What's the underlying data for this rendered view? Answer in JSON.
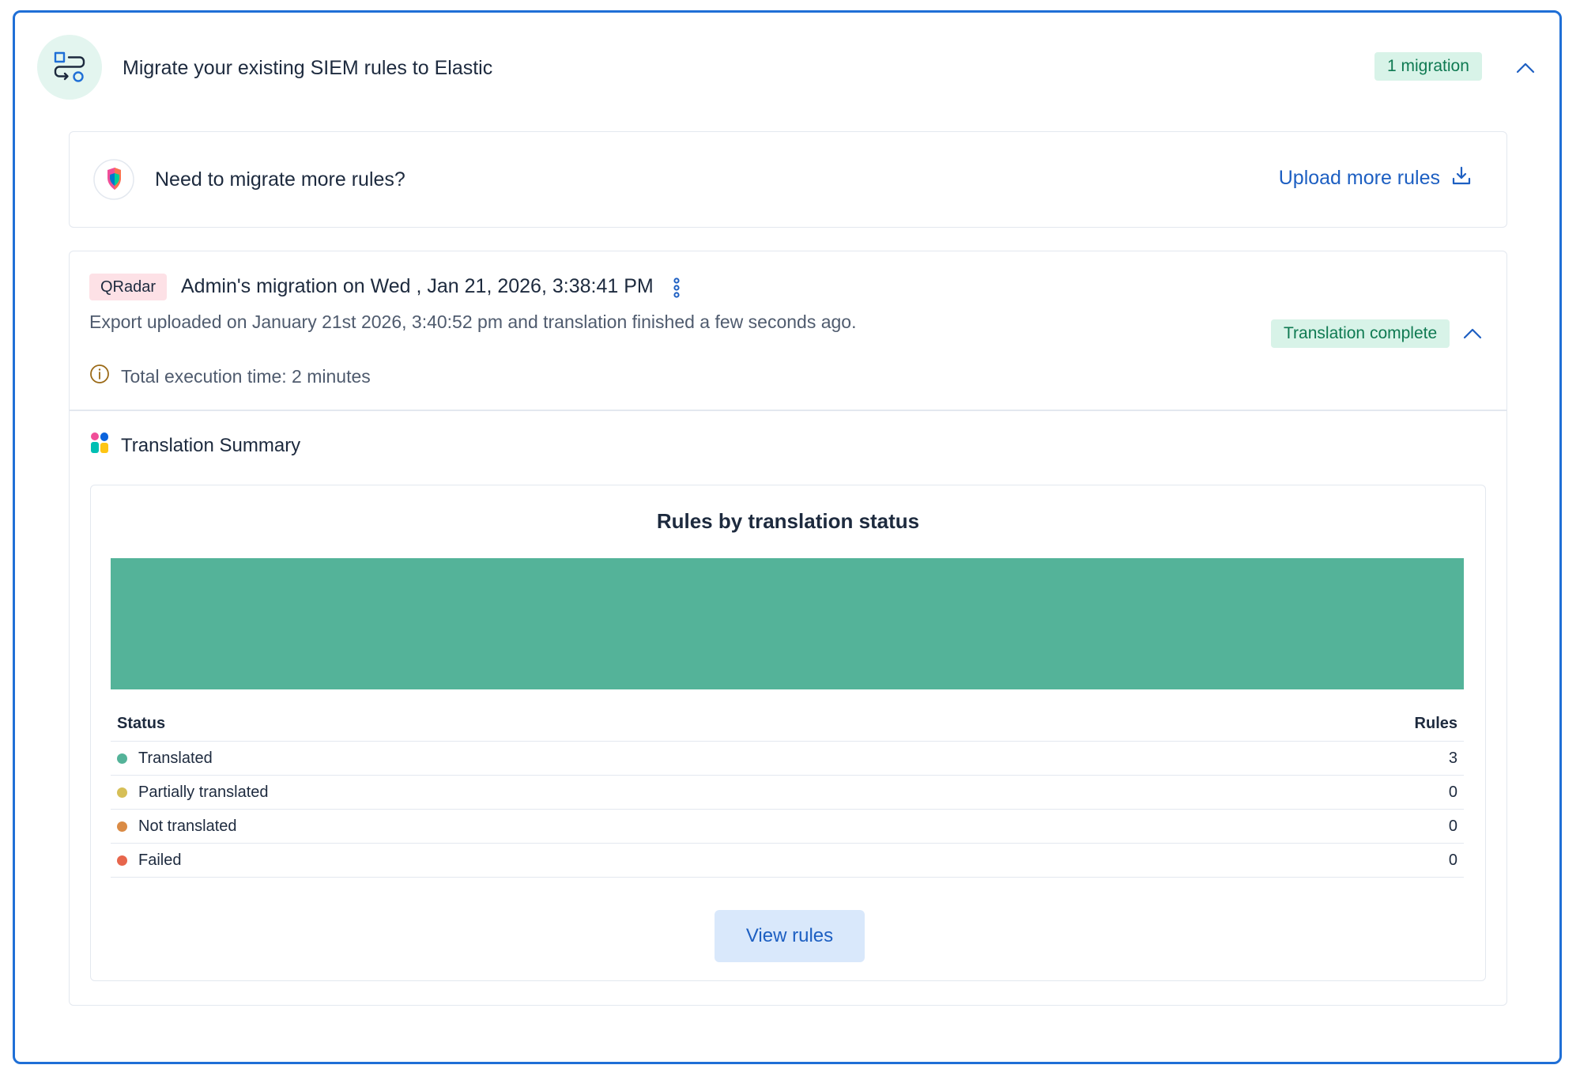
{
  "header": {
    "title": "Migrate your existing SIEM rules to Elastic",
    "migration_count": "1 migration",
    "icon": "rules-migration-icon"
  },
  "upload_panel": {
    "question": "Need to migrate more rules?",
    "link_label": "Upload more rules",
    "icon": "download-icon"
  },
  "migration": {
    "source_badge": "QRadar",
    "title": "Admin's migration on Wed , Jan 21, 2026, 3:38:41 PM",
    "subtitle": "Export uploaded on January 21st 2026, 3:40:52 pm and translation finished a few seconds ago.",
    "status_badge": "Translation complete",
    "execution_time": "Total execution time: 2 minutes"
  },
  "summary": {
    "title": "Translation Summary",
    "button_label": "View rules"
  },
  "chart_data": {
    "type": "bar",
    "title": "Rules by translation status",
    "categories": [
      "Translated",
      "Partially translated",
      "Not translated",
      "Failed"
    ],
    "values": [
      3,
      0,
      0,
      0
    ],
    "colors": [
      "#54b399",
      "#d6bf57",
      "#da8b45",
      "#e7664c"
    ],
    "table_headers": [
      "Status",
      "Rules"
    ]
  }
}
